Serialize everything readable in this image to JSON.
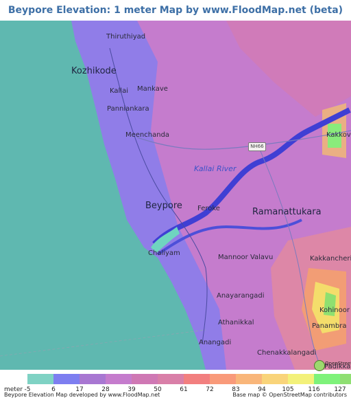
{
  "title": "Beypore Elevation: 1 meter Map by www.FloodMap.net (beta)",
  "map": {
    "places": {
      "thiruthiyad": "Thiruthiyad",
      "kozhikode": "Kozhikode",
      "kallai": "Kallai",
      "mankave": "Mankave",
      "panniankara": "Panniankara",
      "meenchanda": "Meenchanda",
      "kakkov": "Kakkov",
      "kallai_river": "Kallai River",
      "beypore": "Beypore",
      "feroke": "Feroke",
      "ramanattukara": "Ramanattukara",
      "chaliyam": "Chaliyam",
      "mannoor_valavu": "Mannoor Valavu",
      "kakkancheri": "Kakkancheri",
      "anayarangadi": "Anayarangadi",
      "kohinoor": "Kohinoor",
      "athanikkal": "Athanikkal",
      "panambra": "Panambra",
      "anangadi": "Anangadi",
      "chenakkalangadi": "Chenakkalangadi",
      "padikkal": "Padikkal"
    },
    "road_shield": "NH66",
    "attribution_logo_text": "OpenStreetMap"
  },
  "legend": {
    "unit_label": "meter",
    "ticks": [
      "-5",
      "6",
      "17",
      "28",
      "39",
      "50",
      "61",
      "72",
      "83",
      "94",
      "105",
      "116",
      "127"
    ],
    "colors": [
      "#7fd2c4",
      "#7d7ef0",
      "#a877d2",
      "#c57ccd",
      "#cf78b4",
      "#d97fa8",
      "#f27f7f",
      "#f99a7a",
      "#f9b67a",
      "#f9d47a",
      "#f3f17a",
      "#7ef27a",
      "#8fdf72"
    ]
  },
  "footer": {
    "left": "Beypore Elevation Map developed by www.FloodMap.net",
    "right": "Base map © OpenStreetMap contributors"
  }
}
